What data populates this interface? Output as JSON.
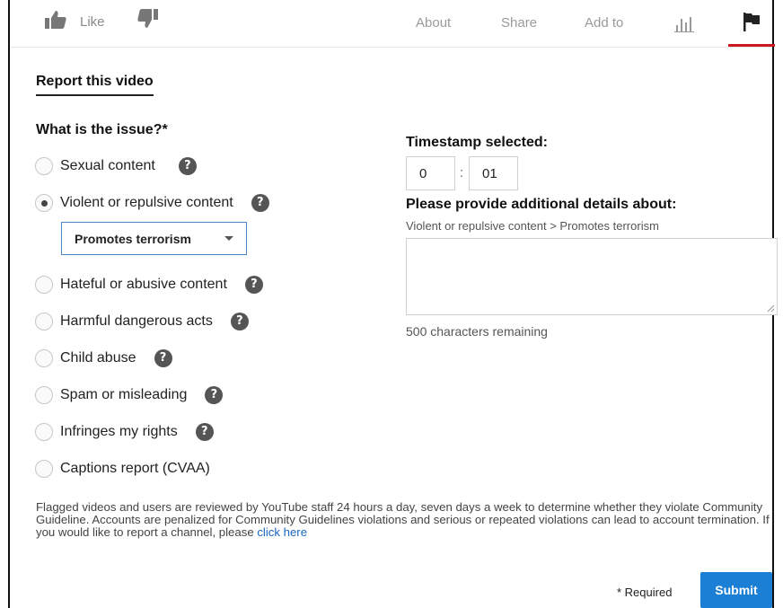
{
  "topbar": {
    "like_label": "Like",
    "tabs": {
      "about": "About",
      "share": "Share",
      "add_to": "Add to"
    },
    "icons": [
      "thumbs-up-icon",
      "thumbs-down-icon",
      "stats-icon",
      "flag-icon"
    ],
    "active_color": "#cc181e"
  },
  "report": {
    "title": "Report this video",
    "question": "What is the issue?*",
    "options": [
      {
        "label": "Sexual content",
        "help": "?",
        "checked": false
      },
      {
        "label": "Violent or repulsive content",
        "help": "?",
        "checked": true
      },
      {
        "label": "Hateful or abusive content",
        "help": "?",
        "checked": false
      },
      {
        "label": "Harmful dangerous acts",
        "help": "?",
        "checked": false
      },
      {
        "label": "Child abuse",
        "help": "?",
        "checked": false
      },
      {
        "label": "Spam or misleading",
        "help": "?",
        "checked": false
      },
      {
        "label": "Infringes my rights",
        "help": "?",
        "checked": false
      },
      {
        "label": "Captions report (CVAA)",
        "checked": false
      }
    ],
    "sub_select": {
      "value": "Promotes terrorism"
    }
  },
  "timestamp": {
    "heading": "Timestamp selected:",
    "minutes": "0",
    "separator": ":",
    "seconds": "01"
  },
  "details": {
    "heading": "Please provide additional details about:",
    "path": "Violent or repulsive content > Promotes terrorism",
    "value": "",
    "chars_remaining": "500 characters remaining"
  },
  "footer": {
    "disclaimer": "Flagged videos and users are reviewed by YouTube staff 24 hours a day, seven days a week to determine whether they violate Community Guideline. Accounts are penalized for Community Guidelines violations and serious or repeated violations can lead to account termination. If you would like to report a channel, please",
    "link": "click here",
    "required": "* Required",
    "submit": "Submit",
    "link_color": "#1a66c4",
    "submit_color": "#1c7fd6"
  }
}
